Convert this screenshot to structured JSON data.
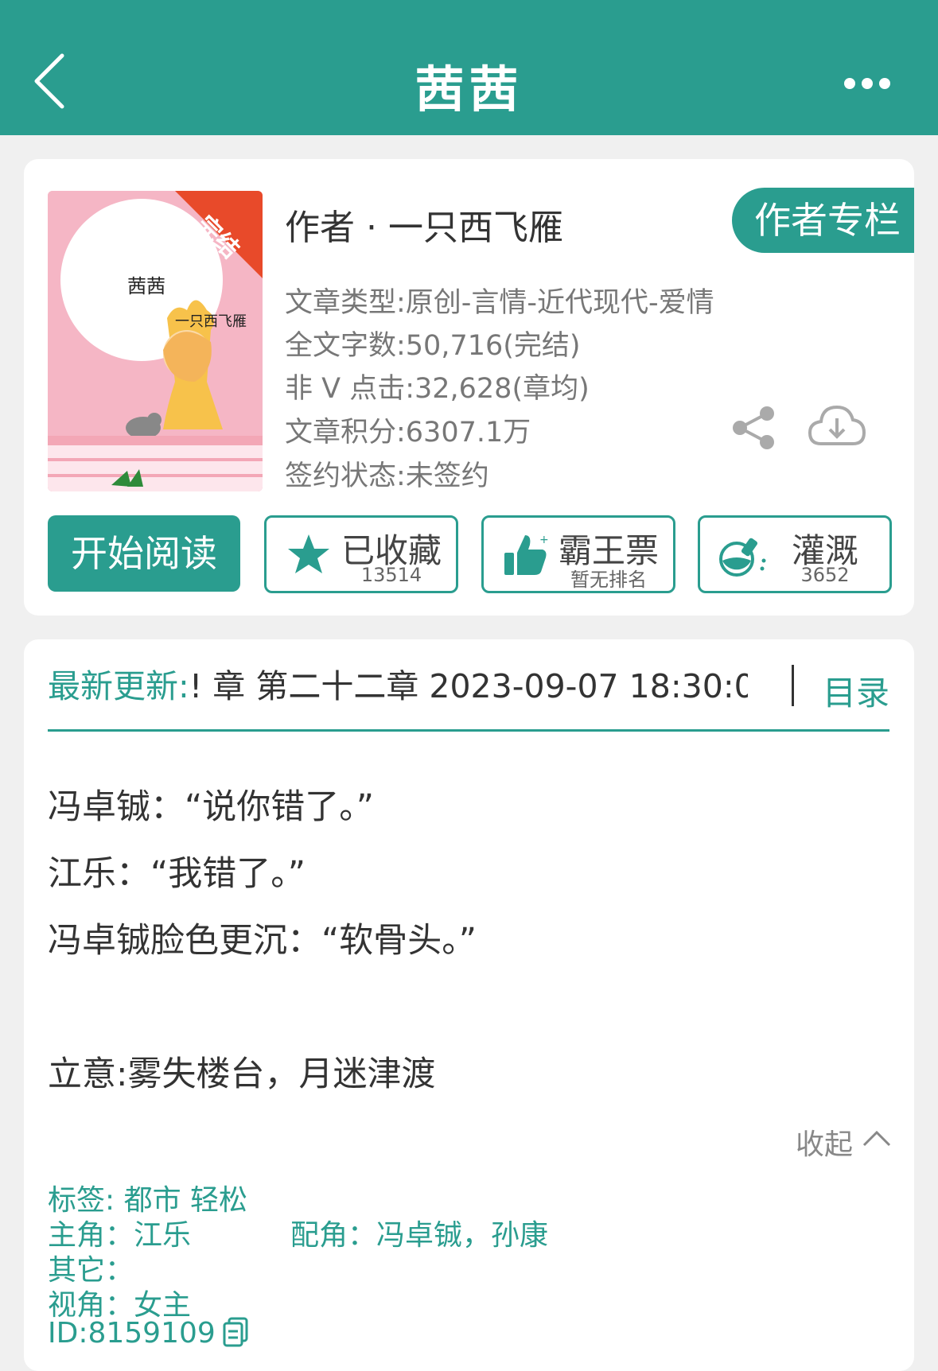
{
  "nav": {
    "title": "茜茜"
  },
  "cover": {
    "badge": "完结",
    "title": "茜茜",
    "author": "一只西飞雁"
  },
  "book": {
    "author": "作者 · 一只西飞雁",
    "author_column_btn": "作者专栏",
    "type": "文章类型:原创-言情-近代现代-爱情",
    "words": "全文字数:50,716(完结)",
    "clicks": "非 V 点击:32,628(章均)",
    "score": "文章积分:6307.1万",
    "sign": "签约状态:未签约"
  },
  "actions": {
    "read": "开始阅读",
    "collect": {
      "label": "已收藏",
      "count": "13514"
    },
    "vote": {
      "label": "霸王票",
      "sub": "暂无排名"
    },
    "nutrient": {
      "label": "灌溉",
      "count": "3652"
    }
  },
  "latest": {
    "label": "最新更新:",
    "value": "! 章 第二十二章 2023-09-07 18:30:0",
    "toc": "目录"
  },
  "desc": [
    "冯卓铖：“说你错了。”",
    "江乐：“我错了。”",
    "冯卓铖脸色更沉：“软骨头。”",
    "立意:雾失楼台，月迷津渡"
  ],
  "collapse": "收起",
  "meta": {
    "tags": "标签:  都市  轻松",
    "lead": "主角：江乐",
    "support": "配角：冯卓铖，孙康",
    "other": "其它：",
    "view": "视角：女主",
    "id": "ID:8159109"
  },
  "colors": {
    "brand": "#2a9d8f"
  }
}
